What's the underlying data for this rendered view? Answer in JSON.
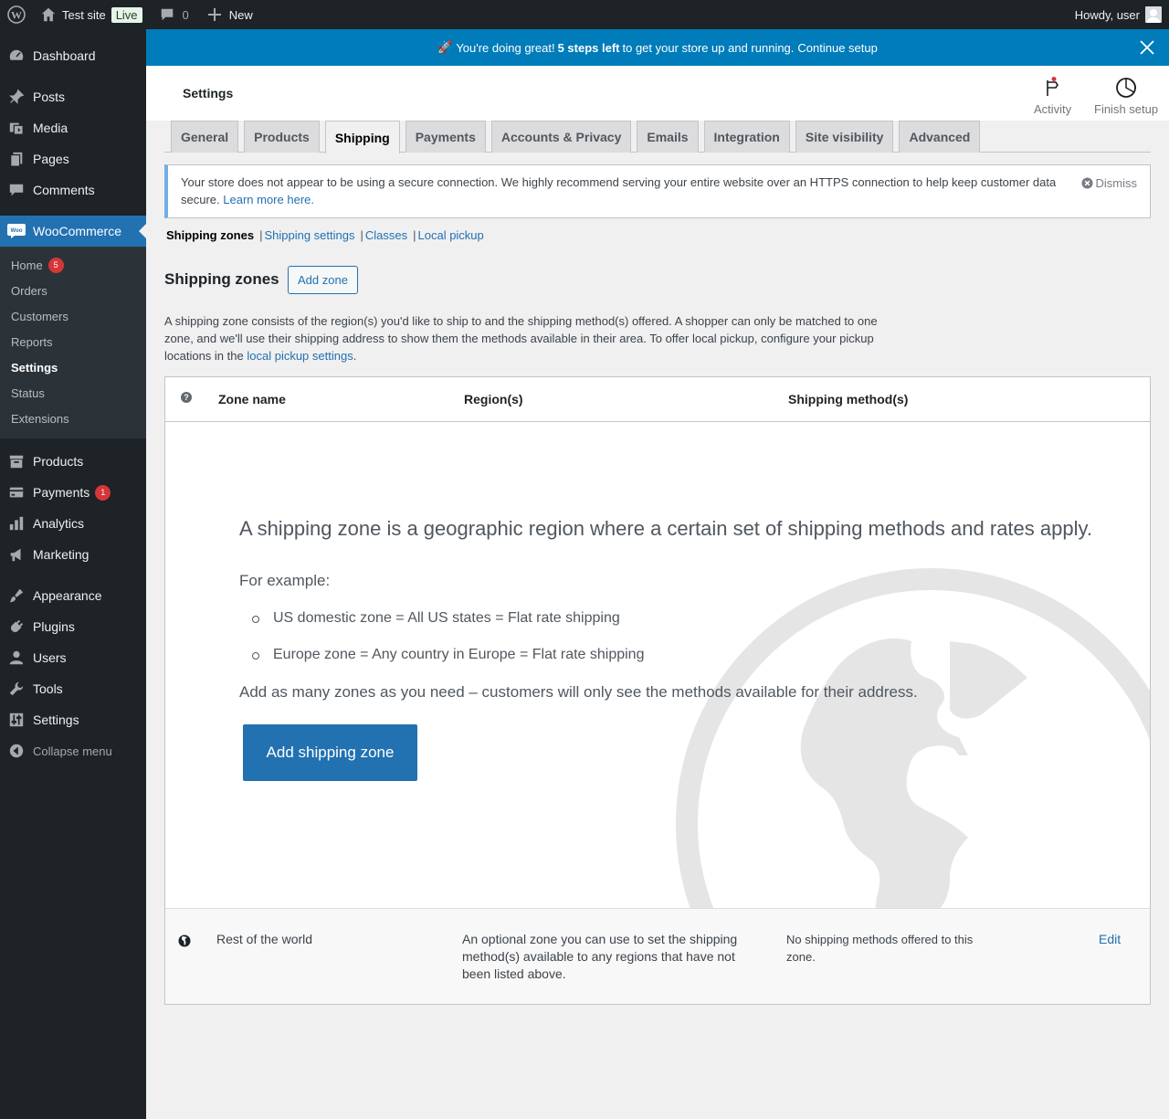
{
  "admin_bar": {
    "site_name": "Test site",
    "live_label": "Live",
    "comments_count": "0",
    "new_label": "New",
    "howdy": "Howdy, user"
  },
  "sidebar": {
    "dashboard": "Dashboard",
    "posts": "Posts",
    "media": "Media",
    "pages": "Pages",
    "comments": "Comments",
    "woocommerce": "WooCommerce",
    "woo_submenu": {
      "home": "Home",
      "home_badge": "5",
      "orders": "Orders",
      "customers": "Customers",
      "reports": "Reports",
      "settings": "Settings",
      "status": "Status",
      "extensions": "Extensions"
    },
    "products": "Products",
    "payments": "Payments",
    "payments_badge": "1",
    "analytics": "Analytics",
    "marketing": "Marketing",
    "appearance": "Appearance",
    "plugins": "Plugins",
    "users": "Users",
    "tools": "Tools",
    "settings": "Settings",
    "collapse": "Collapse menu"
  },
  "banner": {
    "emoji": "🚀",
    "text_before": "You're doing great!",
    "steps": "5 steps left",
    "text_after": "to get your store up and running.",
    "link": "Continue setup"
  },
  "header": {
    "title": "Settings",
    "activity": "Activity",
    "finish_setup": "Finish setup"
  },
  "tabs": [
    "General",
    "Products",
    "Shipping",
    "Payments",
    "Accounts & Privacy",
    "Emails",
    "Integration",
    "Site visibility",
    "Advanced"
  ],
  "notice": {
    "text": "Your store does not appear to be using a secure connection. We highly recommend serving your entire website over an HTTPS connection to help keep customer data secure.",
    "link": "Learn more here.",
    "dismiss": "Dismiss"
  },
  "subnav": {
    "zones": "Shipping zones",
    "settings": "Shipping settings",
    "classes": "Classes",
    "local_pickup": "Local pickup"
  },
  "zones": {
    "heading": "Shipping zones",
    "add_zone": "Add zone",
    "desc_before": "A shipping zone consists of the region(s) you'd like to ship to and the shipping method(s) offered. A shopper can only be matched to one zone, and we'll use their shipping address to show them the methods available in their area. To offer local pickup, configure your pickup locations in the",
    "desc_link": "local pickup settings",
    "desc_after": ".",
    "columns": {
      "help": "?",
      "zone_name": "Zone name",
      "regions": "Region(s)",
      "methods": "Shipping method(s)"
    },
    "blank": {
      "headline": "A shipping zone is a geographic region where a certain set of shipping methods and rates apply.",
      "for_example": "For example:",
      "examples": [
        "US domestic zone = All US states = Flat rate shipping",
        "Europe zone = Any country in Europe = Flat rate shipping"
      ],
      "more": "Add as many zones as you need – customers will only see the methods available for their address.",
      "button": "Add shipping zone"
    },
    "rest": {
      "name": "Rest of the world",
      "region": "An optional zone you can use to set the shipping method(s) available to any regions that have not been listed above.",
      "methods": "No shipping methods offered to this zone.",
      "edit": "Edit"
    }
  },
  "colors": {
    "admin_bg": "#1d2327",
    "accent": "#2271b1",
    "banner_bg": "#007cba",
    "badge_red": "#d63638"
  }
}
